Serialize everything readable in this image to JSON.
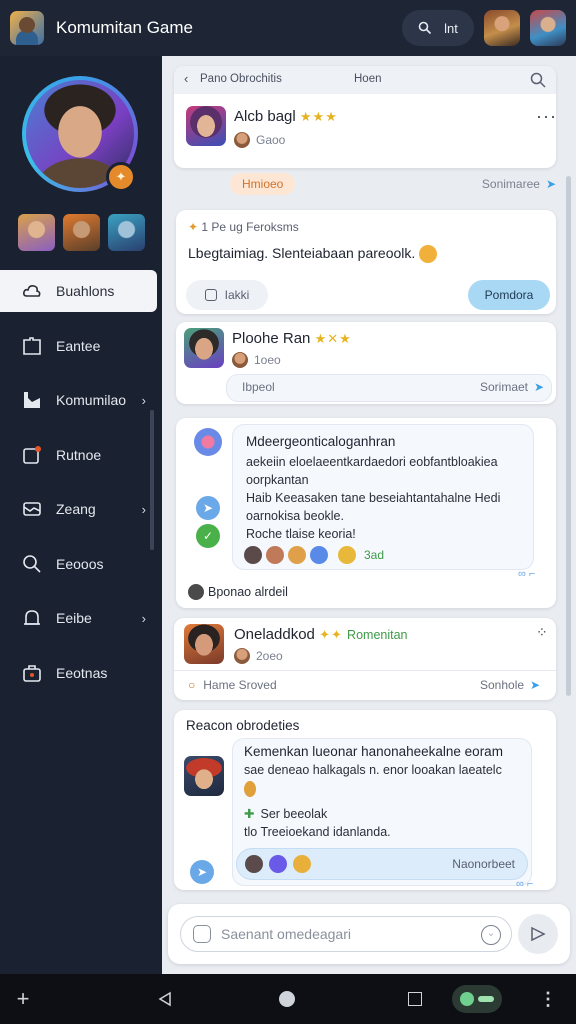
{
  "topbar": {
    "title": "Komumitan Game",
    "search_label": "lnt"
  },
  "sidebar": {
    "items": [
      {
        "label": "Buahlons",
        "icon": "cloud-icon",
        "active": true,
        "chevron": false
      },
      {
        "label": "Eantee",
        "icon": "folder-icon",
        "active": false,
        "chevron": false
      },
      {
        "label": "Komumilao",
        "icon": "inbox-icon",
        "active": false,
        "chevron": true
      },
      {
        "label": "Rutnoe",
        "icon": "edit-icon",
        "active": false,
        "chevron": false
      },
      {
        "label": "Zeang",
        "icon": "mail-icon",
        "active": false,
        "chevron": true
      },
      {
        "label": "Eeooos",
        "icon": "search-icon",
        "active": false,
        "chevron": false
      },
      {
        "label": "Eeibe",
        "icon": "bell-icon",
        "active": false,
        "chevron": true
      },
      {
        "label": "Eeotnas",
        "icon": "briefcase-icon",
        "active": false,
        "chevron": false
      }
    ]
  },
  "feed": {
    "header": {
      "back_label": "Pano Obrochitis",
      "center_label": "Hoen"
    },
    "post1": {
      "name": "Alcb bagl",
      "stars": "★★★",
      "sub": "Gaoo"
    },
    "sep1": {
      "chip": "Hmioeo",
      "action": "Sonimaree"
    },
    "post2": {
      "meta": "1 Pe  ug Feroksms",
      "text": "Lbegtaimiag. Slenteiabaan pareoolk.",
      "left_button": "Iakki",
      "right_button": "Pomdora"
    },
    "post3": {
      "name": "Ploohe Ran",
      "stars": "★✕★",
      "sub": "1oeo",
      "reply_left": "Ibpeol",
      "reply_right": "Sorimaet"
    },
    "post4": {
      "lines": [
        "Mdeergeonticaloganhran",
        "aekeiin eloelaeentkardaedori eobfantbloakiea",
        "oorpkantan",
        "Haib  Keeasaken  tane beseiahtantahalne Hedi",
        "oarnokisa  beokle.",
        "Roche tlaise keoria!"
      ],
      "tag": "Keeasaken",
      "tag2": "beokle.",
      "react_count": "3ad",
      "footer": "Bponao alrdeil"
    },
    "post5": {
      "name": "Oneladdkod",
      "badge": "Romenitan",
      "sub": "2oeo",
      "reply_left": "Hame Sroved",
      "reply_right": "Sonhole"
    },
    "post6": {
      "title": "Reacon obrodeties",
      "lines": [
        "Kemenkan lueonar hanonaheekalne eoram",
        "sae deneao halkagals n. enor looakan laeatelc",
        "Ser beeolak",
        "tlo Treeioekand idanlanda."
      ],
      "quote": "Naonorbeet"
    }
  },
  "composer": {
    "placeholder": "Saenant omedeagari"
  }
}
